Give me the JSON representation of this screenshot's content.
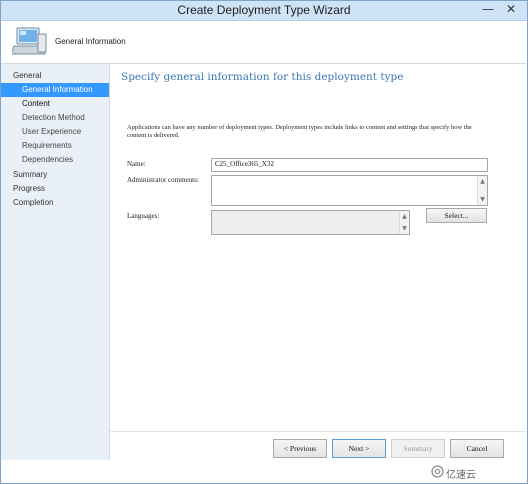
{
  "window": {
    "title": "Create Deployment Type Wizard",
    "controls": {
      "minimize": "—",
      "close": "✕"
    }
  },
  "header": {
    "title": "General Information"
  },
  "nav": {
    "items": [
      {
        "label": "General",
        "level": "top",
        "selected": false
      },
      {
        "label": "General Information",
        "level": "sub",
        "selected": true
      },
      {
        "label": "Content",
        "level": "subbold",
        "selected": false
      },
      {
        "label": "Detection Method",
        "level": "sub",
        "selected": false
      },
      {
        "label": "User Experience",
        "level": "sub",
        "selected": false
      },
      {
        "label": "Requirements",
        "level": "sub",
        "selected": false
      },
      {
        "label": "Dependencies",
        "level": "sub",
        "selected": false
      },
      {
        "label": "Summary",
        "level": "top",
        "selected": false
      },
      {
        "label": "Progress",
        "level": "top",
        "selected": false
      },
      {
        "label": "Completion",
        "level": "top",
        "selected": false
      }
    ]
  },
  "main": {
    "title": "Specify general information for this deployment type",
    "description": "Applications can have any number of deployment types. Deployment types include links to content and settings that specify how the content is delivered.",
    "name_label": "Name:",
    "name_value": "C25_Office365_X32",
    "admin_comments_label": "Administrator comments:",
    "languages_label": "Languages:",
    "select_button": "Select..."
  },
  "buttons": {
    "previous": "< Previous",
    "next": "Next >",
    "summary": "Summary",
    "cancel": "Cancel"
  },
  "watermark": "亿速云",
  "colors": {
    "accent": "#3399ff",
    "title": "#3c78b4",
    "nav_bg": "#e9f0f7"
  }
}
